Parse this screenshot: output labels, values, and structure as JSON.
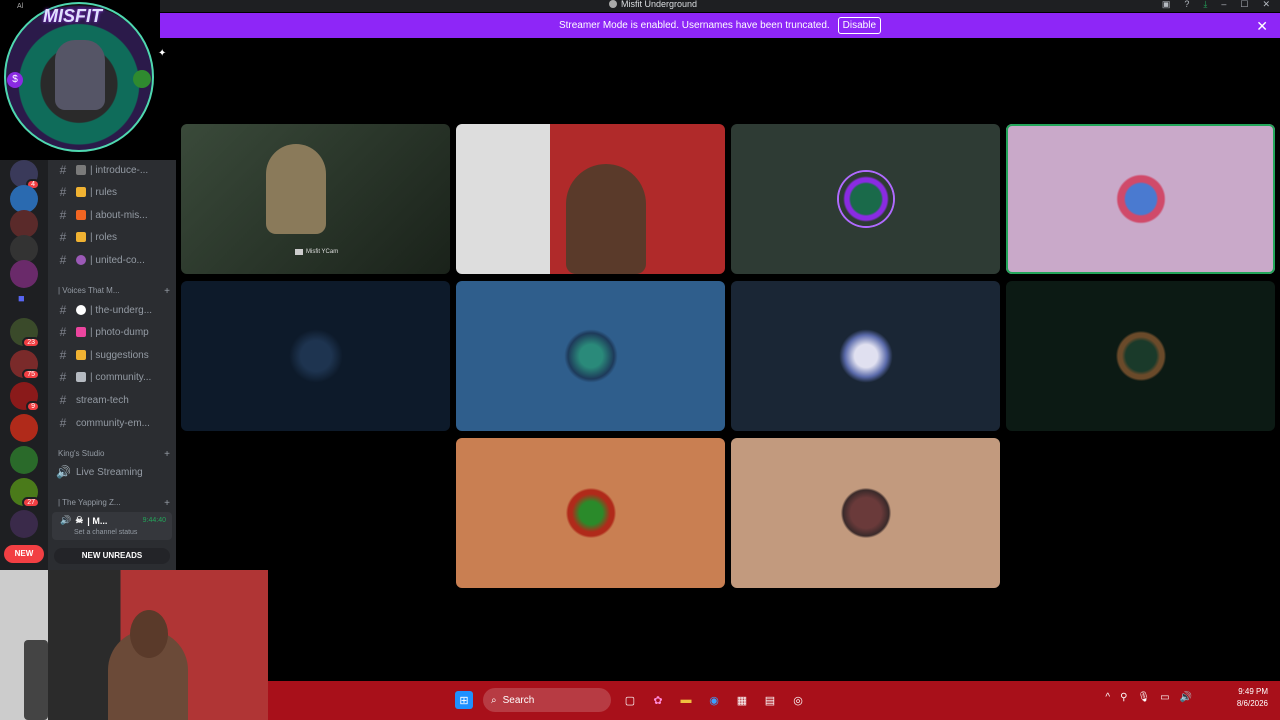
{
  "window": {
    "title": "Misfit Underground"
  },
  "banner": {
    "text": "Streamer Mode is enabled. Usernames have been truncated.",
    "disable_label": "Disable"
  },
  "logo": {
    "wordmark": "MISFIT",
    "corner_text": "Al"
  },
  "server_rail": {
    "badges": [
      "4",
      "23",
      "75",
      "9",
      "27"
    ],
    "new_label": "NEW"
  },
  "sidebar": {
    "channels": [
      {
        "name": "| introduce-...",
        "emoji_color": "#7a7a7a"
      },
      {
        "name": "| rules",
        "emoji_color": "#f0b232"
      },
      {
        "name": "| about-mis...",
        "emoji_color": "#f26522"
      },
      {
        "name": "| roles",
        "emoji_color": "#f0b232"
      },
      {
        "name": "| united-co...",
        "emoji_color": "#9b59b6"
      }
    ],
    "category_voices": "| Voices That M...",
    "channels2": [
      {
        "name": "| the-underg...",
        "emoji_color": "#ffffff"
      },
      {
        "name": "| photo-dump",
        "emoji_color": "#eb459e"
      },
      {
        "name": "| suggestions",
        "emoji_color": "#f0b232"
      },
      {
        "name": "| community...",
        "emoji_color": "#b5bac1"
      },
      {
        "name": "stream-tech",
        "emoji_color": ""
      },
      {
        "name": "community-em...",
        "emoji_color": ""
      }
    ],
    "category_kings": "King's Studio",
    "live_streaming": "Live Streaming",
    "category_yapping": "| The Yapping Z...",
    "voice_user": {
      "name": "| M...",
      "timer": "9:44:40",
      "status": "Set a channel status"
    },
    "new_unreads": "NEW UNREADS"
  },
  "tiles": {
    "cam_label": "Misfit YCam",
    "colors": {
      "t3": "#2e3b34",
      "t4": "#c9a9c9",
      "t5": "#0d1a2a",
      "t6": "#2f5e8c",
      "t7": "#1a2635",
      "t8": "#0c1a14",
      "t9": "#c97f52",
      "t10": "#c29a7e"
    }
  },
  "taskbar": {
    "search_placeholder": "Search",
    "time": "9:49 PM",
    "date": "8/6/2026"
  }
}
